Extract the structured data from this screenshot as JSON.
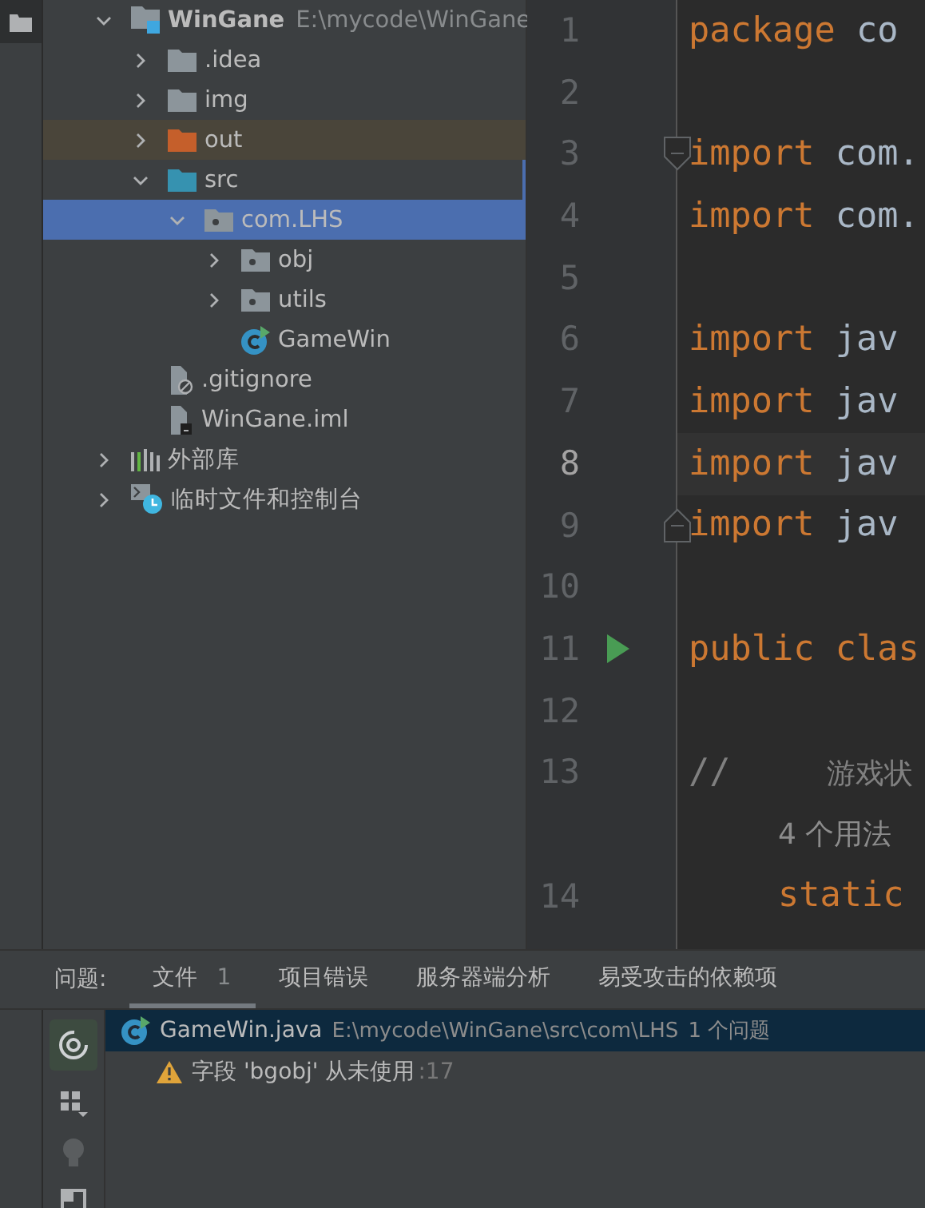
{
  "project_tree": [
    {
      "name": "WinGane",
      "hint": "E:\\mycode\\WinGane",
      "kind": "project",
      "expanded": true,
      "selected": false,
      "children": [
        {
          "name": ".idea",
          "kind": "folder",
          "expanded": false,
          "selected": false
        },
        {
          "name": "img",
          "kind": "folder",
          "expanded": false,
          "selected": false
        },
        {
          "name": "out",
          "kind": "excluded-folder",
          "expanded": false,
          "selected": false
        },
        {
          "name": "src",
          "kind": "source-folder",
          "expanded": true,
          "selected": false,
          "children": [
            {
              "name": "com.LHS",
              "kind": "package",
              "expanded": true,
              "selected": true,
              "children": [
                {
                  "name": "obj",
                  "kind": "package",
                  "expanded": false,
                  "selected": false
                },
                {
                  "name": "utils",
                  "kind": "package",
                  "expanded": false,
                  "selected": false
                },
                {
                  "name": "GameWin",
                  "kind": "class",
                  "selected": false
                }
              ]
            }
          ]
        },
        {
          "name": ".gitignore",
          "kind": "ignore-file",
          "selected": false
        },
        {
          "name": "WinGane.iml",
          "kind": "module-file",
          "selected": false
        }
      ]
    },
    {
      "name": "外部库",
      "kind": "libraries",
      "expanded": false,
      "selected": false
    },
    {
      "name": "临时文件和控制台",
      "kind": "scratches",
      "expanded": false,
      "selected": false
    }
  ],
  "editor": {
    "lines": [
      {
        "kind": "code",
        "number": "1",
        "tokens": [
          {
            "kind": "keyword",
            "text": "package"
          },
          {
            "kind": "text",
            "text": " co"
          }
        ]
      },
      {
        "kind": "code",
        "number": "2"
      },
      {
        "kind": "code",
        "number": "3",
        "fold_start": true,
        "tokens": [
          {
            "kind": "keyword",
            "text": "import"
          },
          {
            "kind": "text",
            "text": " com."
          }
        ]
      },
      {
        "kind": "code",
        "number": "4",
        "tokens": [
          {
            "kind": "keyword",
            "text": "import"
          },
          {
            "kind": "text",
            "text": " com."
          }
        ]
      },
      {
        "kind": "code",
        "number": "5"
      },
      {
        "kind": "code",
        "number": "6",
        "tokens": [
          {
            "kind": "keyword",
            "text": "import"
          },
          {
            "kind": "text",
            "text": " jav"
          }
        ]
      },
      {
        "kind": "code",
        "number": "7",
        "tokens": [
          {
            "kind": "keyword",
            "text": "import"
          },
          {
            "kind": "text",
            "text": " jav"
          }
        ]
      },
      {
        "kind": "code",
        "number": "8",
        "current": true,
        "tokens": [
          {
            "kind": "keyword",
            "text": "import"
          },
          {
            "kind": "text",
            "text": " jav"
          }
        ]
      },
      {
        "kind": "code",
        "number": "9",
        "fold_end": true,
        "tokens": [
          {
            "kind": "keyword",
            "text": "import"
          },
          {
            "kind": "text",
            "text": " jav"
          }
        ]
      },
      {
        "kind": "code",
        "number": "10"
      },
      {
        "kind": "code",
        "number": "11",
        "run": true,
        "tokens": [
          {
            "kind": "keyword",
            "text": "public"
          },
          {
            "kind": "keyword",
            "text": " clas"
          }
        ]
      },
      {
        "kind": "code",
        "number": "12"
      },
      {
        "kind": "code",
        "number": "13",
        "tokens": [
          {
            "kind": "comment",
            "text": "//"
          },
          {
            "kind": "comment-note",
            "text": "游戏状"
          }
        ]
      },
      {
        "kind": "inlay",
        "text": "4 个用法"
      },
      {
        "kind": "code",
        "number": "14",
        "indented": true,
        "tokens": [
          {
            "kind": "keyword",
            "text": "static"
          }
        ]
      }
    ]
  },
  "problems": {
    "label": "问题:",
    "tabs": [
      {
        "label": "文件",
        "count": "1",
        "selected": true
      },
      {
        "label": "项目错误",
        "selected": false
      },
      {
        "label": "服务器端分析",
        "selected": false
      },
      {
        "label": "易受攻击的依赖项",
        "selected": false
      }
    ],
    "files": [
      {
        "name": "GameWin.java",
        "path": "E:\\mycode\\WinGane\\src\\com\\LHS",
        "summary": "1 个问题",
        "selected": true,
        "children": [
          {
            "kind": "warning",
            "text": "字段 'bgobj' 从未使用",
            "location": ":17"
          }
        ]
      }
    ]
  }
}
